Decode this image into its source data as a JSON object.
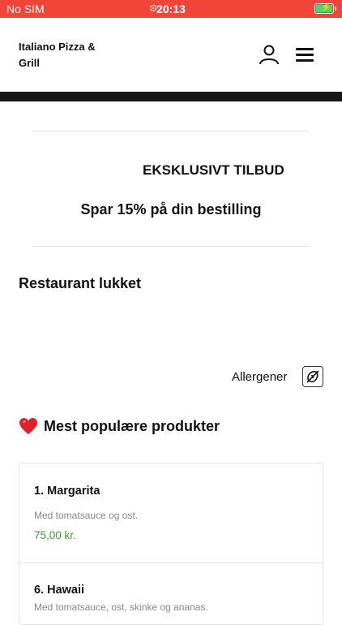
{
  "status_bar": {
    "carrier": "No SIM",
    "time": "20:13"
  },
  "header": {
    "brand": "Italiano Pizza & Grill",
    "account_icon": "user-icon",
    "menu_icon": "hamburger-menu-icon"
  },
  "offer": {
    "title": "EKSKLUSIVT TILBUD",
    "subtitle": "Spar 15% på din bestilling"
  },
  "restaurant_status": "Restaurant lukket",
  "allergens": {
    "label": "Allergener",
    "icon": "allergen-icon"
  },
  "popular": {
    "icon": "heart-icon",
    "title": "Mest populære produkter",
    "products": [
      {
        "name": "1. Margarita",
        "description": "Med tomatsauce og ost.",
        "price": "75,00 kr."
      },
      {
        "name": "6. Hawaii",
        "description": "Med tomatsauce, ost, skinke og ananas."
      }
    ]
  },
  "colors": {
    "status_bar": "#f3443a",
    "price": "#3da12e",
    "heart": "#e0202b"
  }
}
